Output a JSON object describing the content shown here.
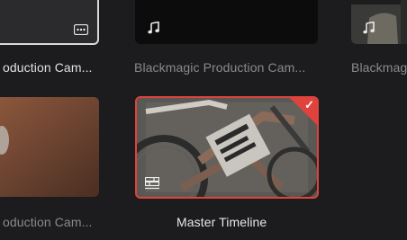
{
  "colors": {
    "background": "#1c1c1e",
    "selection": "#e0433c",
    "caption_active": "#e6e6e6",
    "caption_muted": "#8a8a8c"
  },
  "clips": [
    {
      "label": "Blackmagic Production Cam...",
      "shown": "oduction Cam...",
      "badge": "ellipsis-box-icon",
      "state": "hover"
    },
    {
      "label": "Blackmagic Production Cam...",
      "shown": "Blackmagic Production Cam...",
      "badge": "music-note-icon",
      "state": "normal"
    },
    {
      "label": "Blackmagic",
      "shown": "Blackmag",
      "badge": "music-note-icon",
      "state": "normal"
    },
    {
      "label": "Blackmagic Production Cam...",
      "shown": "oduction Cam...",
      "badge": "",
      "state": "normal"
    },
    {
      "label": "Master Timeline",
      "shown": "Master Timeline",
      "badge": "timeline-icon",
      "state": "selected"
    }
  ]
}
